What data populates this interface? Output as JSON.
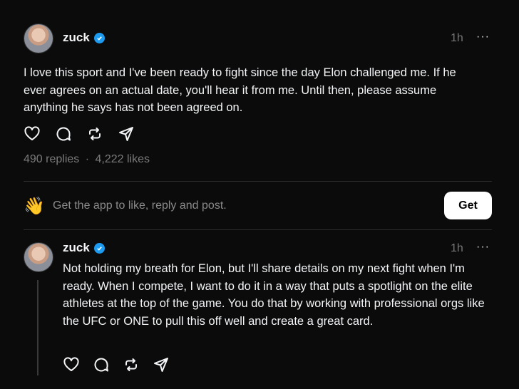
{
  "posts": [
    {
      "username": "zuck",
      "time": "1h",
      "more": "···",
      "text": "I love this sport and I've been ready to fight since the day Elon challenged me. If he ever agrees on an actual date, you'll hear it from me. Until then, please assume anything he says has not been agreed on.",
      "replies": "490 replies",
      "separator": "·",
      "likes": "4,222 likes"
    },
    {
      "username": "zuck",
      "time": "1h",
      "more": "···",
      "text": "Not holding my breath for Elon, but I'll share details on my next fight when I'm ready. When I compete, I want to do it in a way that puts a spotlight on the elite athletes at the top of the game. You do that by working with professional orgs like the UFC or ONE to pull this off well and create a great card."
    }
  ],
  "cta": {
    "emoji": "👋",
    "text": "Get the app to like, reply and post.",
    "button": "Get"
  },
  "colors": {
    "background": "#0b0b0b",
    "verified": "#1d9bf0",
    "muted": "#777777"
  }
}
